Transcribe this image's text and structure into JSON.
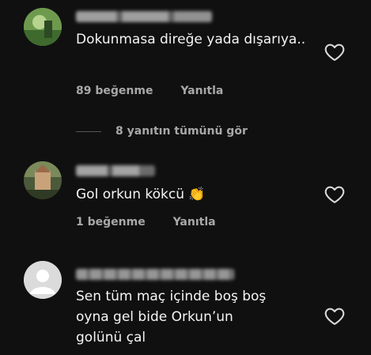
{
  "comments": [
    {
      "username": "m______d",
      "text": "Dokunmasa direğe yada dışarıya..",
      "likes": "89 beğenme",
      "reply": "Yanıtla",
      "view_replies": "8 yanıtın tümünü gör"
    },
    {
      "username": "m___d",
      "text": "Gol orkun kökcü 👏",
      "likes": "1 beğenme",
      "reply": "Yanıtla"
    },
    {
      "username": "",
      "text": "Sen tüm maç içinde boş boş oyna gel bide Orkun’un golünü çal"
    }
  ]
}
